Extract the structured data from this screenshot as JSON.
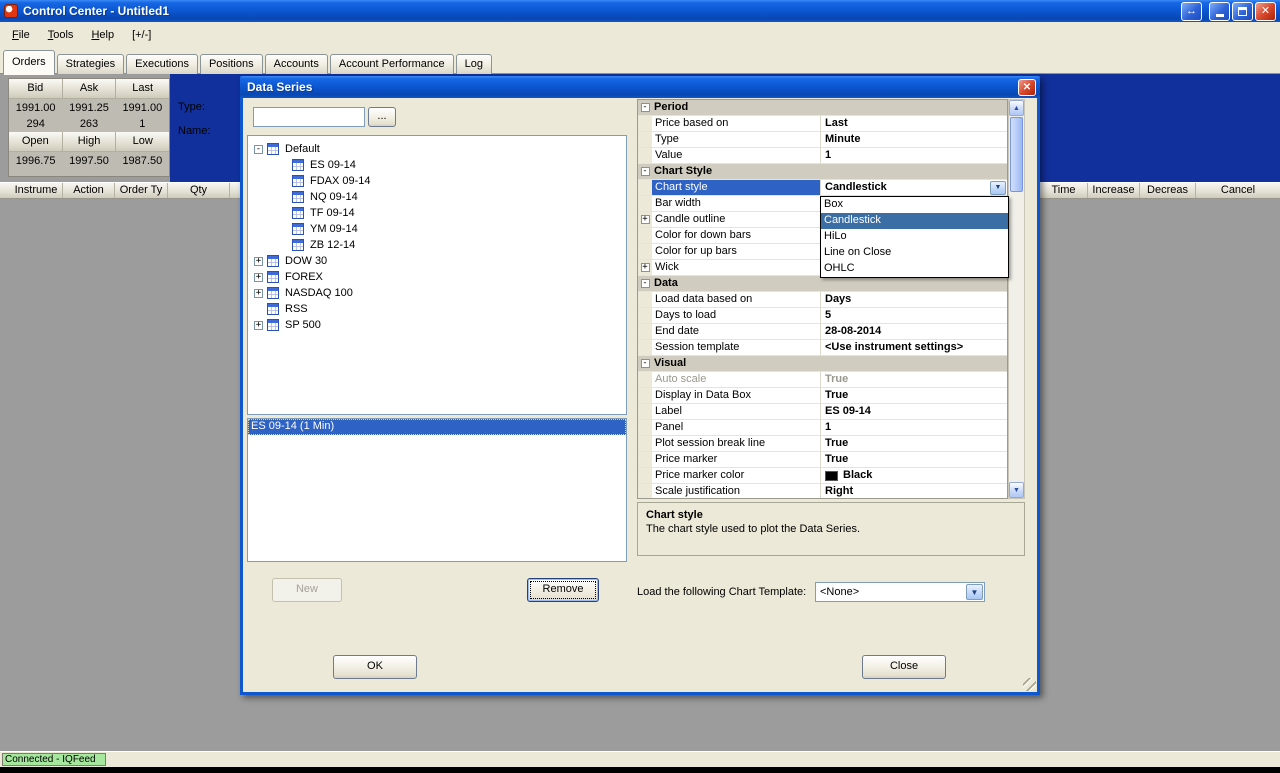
{
  "icons": {
    "plus": "+",
    "minus": "-",
    "combo_arrow": "▼",
    "scroll_up": "▲",
    "scroll_down": "▼",
    "close": "✕",
    "link": "↔"
  },
  "window": {
    "title": "Control Center - Untitled1",
    "menu": [
      {
        "label": "File"
      },
      {
        "label": "Tools"
      },
      {
        "label": "Help"
      },
      {
        "label": "[+/-]"
      }
    ],
    "tabs": [
      {
        "label": "Orders"
      },
      {
        "label": "Strategies"
      },
      {
        "label": "Executions"
      },
      {
        "label": "Positions"
      },
      {
        "label": "Accounts"
      },
      {
        "label": "Account Performance"
      },
      {
        "label": "Log"
      }
    ],
    "active_tab": "Orders"
  },
  "quote_panel": {
    "headers_top": [
      "Bid",
      "Ask",
      "Last"
    ],
    "row1": [
      "1991.00",
      "1991.25",
      "1991.00"
    ],
    "row2": [
      "294",
      "263",
      "1"
    ],
    "headers_bottom": [
      "Open",
      "High",
      "Low"
    ],
    "row3": [
      "1996.75",
      "1997.50",
      "1987.50"
    ]
  },
  "order_entry": {
    "type_label": "Type:",
    "name_label": "Name:"
  },
  "orders_table": {
    "columns_left": [
      "Instrume",
      "Action",
      "Order Ty",
      "Qty"
    ],
    "columns_right": [
      "Time",
      "Increase",
      "Decreas",
      "Cancel"
    ]
  },
  "status_bar": {
    "connection": "Connected - IQFeed"
  },
  "dialog": {
    "title": "Data Series",
    "search": {
      "value": "",
      "browse_label": "..."
    },
    "tree": {
      "root": "Default",
      "instruments": [
        "ES 09-14",
        "FDAX 09-14",
        "NQ 09-14",
        "TF 09-14",
        "YM 09-14",
        "ZB 12-14"
      ],
      "lists": [
        "DOW 30",
        "FOREX",
        "NASDAQ 100",
        "RSS",
        "SP 500"
      ]
    },
    "series_list": [
      {
        "label": "ES 09-14 (1 Min)",
        "selected": true
      }
    ],
    "buttons": {
      "new": "New",
      "remove": "Remove",
      "ok": "OK",
      "close": "Close"
    },
    "properties": [
      {
        "kind": "category",
        "label": "Period"
      },
      {
        "kind": "prop",
        "label": "Price based on",
        "value": "Last"
      },
      {
        "kind": "prop",
        "label": "Type",
        "value": "Minute"
      },
      {
        "kind": "prop",
        "label": "Value",
        "value": "1"
      },
      {
        "kind": "category",
        "label": "Chart Style"
      },
      {
        "kind": "prop",
        "label": "Chart style",
        "value": "Candlestick",
        "selected": true,
        "combo": true
      },
      {
        "kind": "prop",
        "label": "Bar width",
        "value": ""
      },
      {
        "kind": "prop",
        "label": "Candle outline",
        "value": "",
        "expandable": true
      },
      {
        "kind": "prop",
        "label": "Color for down bars",
        "value": ""
      },
      {
        "kind": "prop",
        "label": "Color for up bars",
        "value": ""
      },
      {
        "kind": "prop",
        "label": "Wick",
        "value": "",
        "expandable": true
      },
      {
        "kind": "category",
        "label": "Data"
      },
      {
        "kind": "prop",
        "label": "Load data based on",
        "value": "Days"
      },
      {
        "kind": "prop",
        "label": "Days to load",
        "value": "5"
      },
      {
        "kind": "prop",
        "label": "End date",
        "value": "28-08-2014"
      },
      {
        "kind": "prop",
        "label": "Session template",
        "value": "<Use instrument settings>"
      },
      {
        "kind": "category",
        "label": "Visual"
      },
      {
        "kind": "prop",
        "label": "Auto scale",
        "value": "True",
        "disabled": true
      },
      {
        "kind": "prop",
        "label": "Display in Data Box",
        "value": "True"
      },
      {
        "kind": "prop",
        "label": "Label",
        "value": "ES 09-14"
      },
      {
        "kind": "prop",
        "label": "Panel",
        "value": "1"
      },
      {
        "kind": "prop",
        "label": "Plot session break line",
        "value": "True"
      },
      {
        "kind": "prop",
        "label": "Price marker",
        "value": "True"
      },
      {
        "kind": "prop",
        "label": "Price marker color",
        "value": "Black",
        "swatch": "#000000"
      },
      {
        "kind": "prop",
        "label": "Scale justification",
        "value": "Right"
      }
    ],
    "dropdown": {
      "options": [
        "Box",
        "Candlestick",
        "HiLo",
        "Line on Close",
        "OHLC"
      ],
      "selected": "Candlestick"
    },
    "description": {
      "title": "Chart style",
      "text": "The chart style used to plot the Data Series."
    },
    "template": {
      "label": "Load the following Chart Template:",
      "value": "<None>"
    }
  },
  "colors": {
    "selection": "#2E62C4",
    "dropdown_highlight": "#3A6EA5",
    "connected_green": "#A5E79D",
    "navy_panel": "#12309B",
    "price_marker_color": "#000000"
  }
}
